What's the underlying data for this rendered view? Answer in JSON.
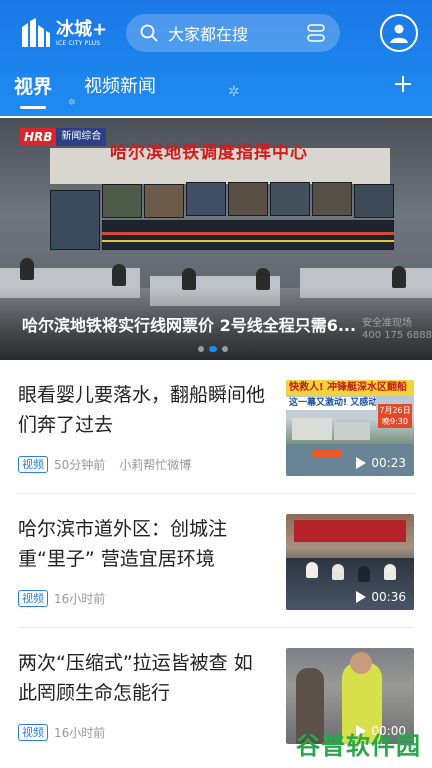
{
  "app": {
    "name": "冰城+",
    "name_en": "ICE CITY PLUS"
  },
  "search": {
    "placeholder": "大家都在搜"
  },
  "tabs": [
    {
      "label": "视界",
      "active": true
    },
    {
      "label": "视频新闻",
      "active": false
    }
  ],
  "banner": {
    "source_logo": "HRB",
    "source_label": "新闻综合",
    "wall_sign": "哈尔滨地铁调度指挥中心",
    "caption": "哈尔滨地铁将实行线网票价 2号线全程只需6...",
    "corner_text": "安全准现场\n400 175 6888",
    "slides": 3,
    "active_slide": 1
  },
  "news": [
    {
      "title": "眼看婴儿要落水，翻船瞬间他们奔了过去",
      "tag": "视频",
      "time": "50分钟前",
      "source": "小莉帮忙微博",
      "duration": "00:23",
      "thumb_caption": "快救人! 冲锋艇深水区翻船",
      "thumb_caption2": "这一幕又激动! 又感动!",
      "thumb_date": "7月26日 晚9:30"
    },
    {
      "title": "哈尔滨市道外区：创城注重“里子” 营造宜居环境",
      "tag": "视频",
      "time": "16小时前",
      "source": "",
      "duration": "00:36"
    },
    {
      "title": "两次“压缩式”拉运皆被查 如此罔顾生命怎能行",
      "tag": "视频",
      "time": "16小时前",
      "source": "",
      "duration": "00:00"
    }
  ],
  "watermark": "谷普软件园",
  "colors": {
    "primary": "#1f8cf2",
    "tag": "#2a7de1",
    "watermark": "#27a84a"
  }
}
